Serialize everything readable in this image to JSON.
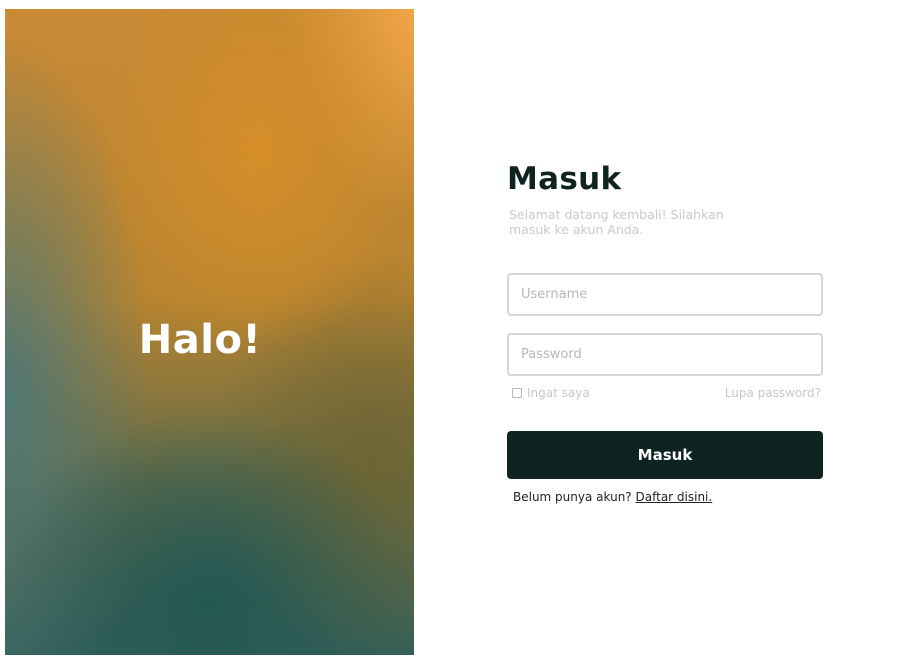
{
  "hero": {
    "title": "Halo!"
  },
  "login": {
    "title": "Masuk",
    "subtitle": "Selamat datang kembali! Silahkan masuk ke akun Anda.",
    "username": {
      "placeholder": "Username",
      "value": ""
    },
    "password": {
      "placeholder": "Password",
      "value": ""
    },
    "remember_label": "Ingat saya",
    "forgot_label": "Lupa password?",
    "submit_label": "Masuk",
    "signup_prompt": "Belum punya akun?",
    "signup_link": "Daftar disini."
  },
  "colors": {
    "primary": "#0f2320",
    "muted_text": "#c7c7c7",
    "input_border": "#d6d6d6"
  },
  "icons": {
    "remember_checkbox": "checkbox-icon"
  }
}
